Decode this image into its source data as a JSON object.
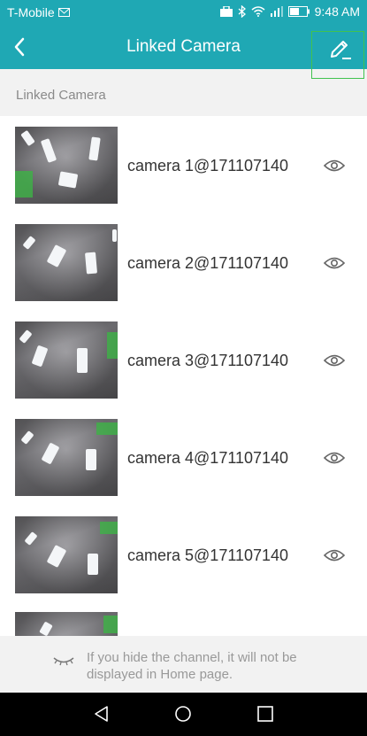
{
  "status_bar": {
    "carrier": "T-Mobile",
    "battery": "",
    "time": "9:48 AM"
  },
  "header": {
    "title": "Linked Camera",
    "back_icon": "chevron-left-icon",
    "edit_icon": "pencil-icon"
  },
  "section": {
    "label": "Linked Camera"
  },
  "cameras": [
    {
      "name": "camera 1@171107140"
    },
    {
      "name": "camera 2@171107140"
    },
    {
      "name": "camera 3@171107140"
    },
    {
      "name": "camera 4@171107140"
    },
    {
      "name": "camera 5@171107140"
    },
    {
      "name": ""
    }
  ],
  "hint": {
    "text": "If you hide the channel, it will not be displayed in Home page."
  },
  "colors": {
    "accent": "#1fa8b4",
    "highlight_box": "#41c24f"
  }
}
